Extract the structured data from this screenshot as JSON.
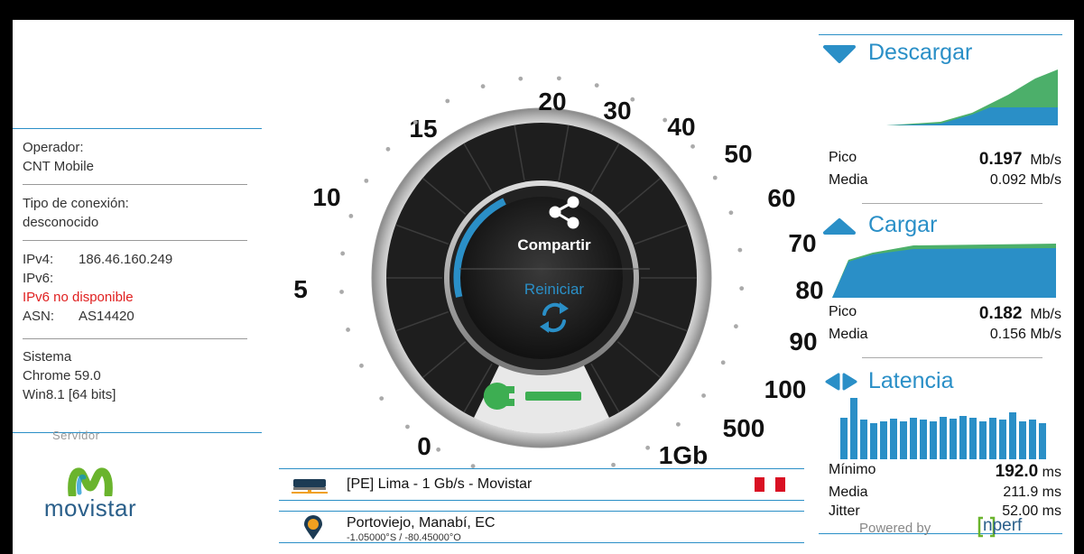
{
  "info": {
    "operator_label": "Operador:",
    "operator_value": "CNT Mobile",
    "conn_label": "Tipo de conexión:",
    "conn_value": "desconocido",
    "ipv4_label": "IPv4:",
    "ipv4_value": "186.46.160.249",
    "ipv6_label": "IPv6:",
    "ipv6_value": "IPv6 no disponible",
    "asn_label": "ASN:",
    "asn_value": "AS14420",
    "system_label": "Sistema",
    "browser": "Chrome 59.0",
    "os": "Win8.1 [64 bits]"
  },
  "server_label": "Servidor",
  "logo_text": "movistar",
  "gauge": {
    "ticks": [
      "0",
      "5",
      "10",
      "15",
      "20",
      "30",
      "40",
      "50",
      "60",
      "70",
      "80",
      "90",
      "100",
      "500",
      "1Gb"
    ],
    "share_label": "Compartir",
    "restart_label": "Reiniciar"
  },
  "server": {
    "name": "[PE] Lima - 1 Gb/s - Movistar",
    "location": "Portoviejo, Manabí, EC",
    "coords": "-1.05000°S / -80.45000°O"
  },
  "download": {
    "title": "Descargar",
    "peak_label": "Pico",
    "peak_value": "0.197",
    "peak_unit": "Mb/s",
    "avg_label": "Media",
    "avg_value": "0.092 Mb/s"
  },
  "upload": {
    "title": "Cargar",
    "peak_label": "Pico",
    "peak_value": "0.182",
    "peak_unit": "Mb/s",
    "avg_label": "Media",
    "avg_value": "0.156 Mb/s"
  },
  "latency": {
    "title": "Latencia",
    "min_label": "Mínimo",
    "min_value": "192.0",
    "min_unit": "ms",
    "avg_label": "Media",
    "avg_value": "211.9 ms",
    "jitter_label": "Jitter",
    "jitter_value": "52.00 ms"
  },
  "powered_by": "Powered by",
  "brand": "nperf",
  "colors": {
    "accent": "#2a8fc7",
    "green": "#4caf50",
    "red": "#e02020",
    "wrench": "#3dae52"
  }
}
